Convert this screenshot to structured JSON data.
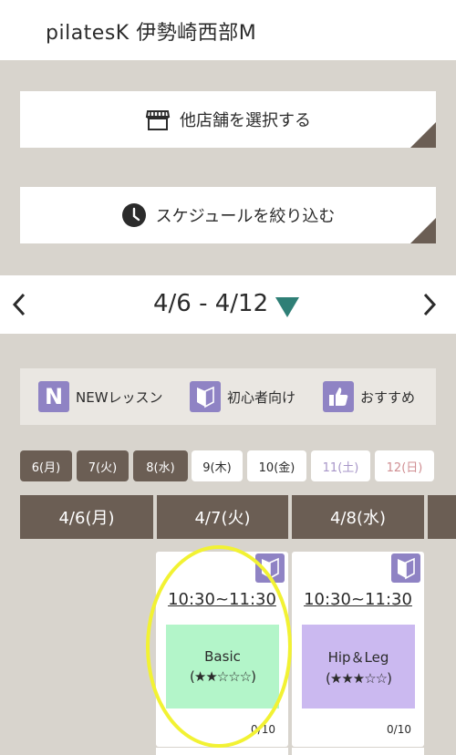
{
  "header": {
    "title": "pilatesK 伊勢崎西部M"
  },
  "buttons": {
    "other_store": {
      "label": "他店舗を選択する",
      "icon": "store-icon"
    },
    "filter_schedule": {
      "label": "スケジュールを絞り込む",
      "icon": "clock-icon"
    }
  },
  "week": {
    "range": "4/6 - 4/12",
    "prev_icon": "chevron-left-icon",
    "next_icon": "chevron-right-icon",
    "dropdown_icon": "triangle-down-icon",
    "dropdown_color": "#2f7f76"
  },
  "legend": {
    "items": [
      {
        "badge": "N",
        "label": "NEWレッスン",
        "icon": "new-lesson-icon"
      },
      {
        "badge": "",
        "label": "初心者向け",
        "icon": "beginner-icon"
      },
      {
        "badge": "",
        "label": "おすすめ",
        "icon": "thumbs-up-icon"
      }
    ],
    "badge_color": "#8f83c4"
  },
  "days": [
    {
      "label": "6(月)",
      "state": "past"
    },
    {
      "label": "7(火)",
      "state": "past"
    },
    {
      "label": "8(水)",
      "state": "past"
    },
    {
      "label": "9(木)",
      "state": "future"
    },
    {
      "label": "10(金)",
      "state": "future"
    },
    {
      "label": "11(土)",
      "state": "sat"
    },
    {
      "label": "12(日)",
      "state": "sun"
    }
  ],
  "columns": [
    "4/6(月)",
    "4/7(火)",
    "4/8(水)"
  ],
  "lessons": [
    {
      "time": "10:30~11:30",
      "name": "Basic",
      "level": "(★★☆☆☆)",
      "capacity": "0/10",
      "color": "#b3f5c9",
      "beginner": true
    },
    {
      "time": "10:30~11:30",
      "name": "Hip＆Leg",
      "level": "(★★★☆☆)",
      "capacity": "0/10",
      "color": "#cbb9f0",
      "beginner": true
    }
  ],
  "colors": {
    "brand_brown": "#6b5e54",
    "background": "#d8d4cd",
    "highlight": "#f2f233"
  }
}
